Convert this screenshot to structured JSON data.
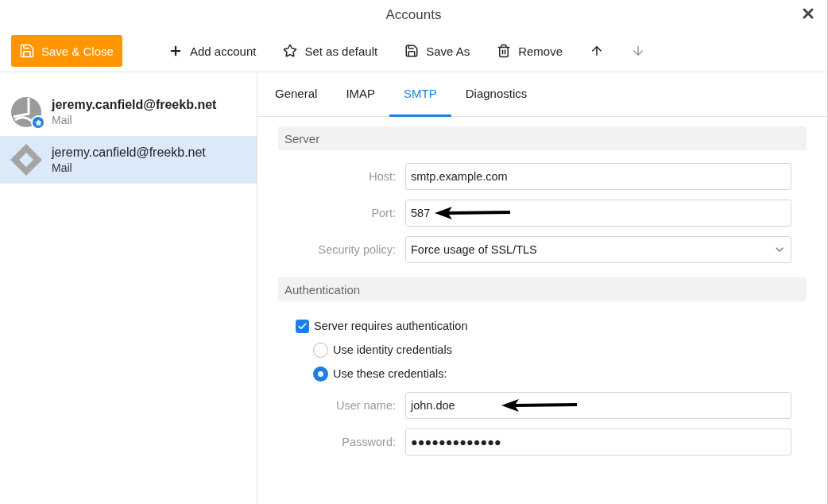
{
  "window": {
    "title": "Accounts"
  },
  "toolbar": {
    "primary": {
      "label": "Save & Close"
    },
    "items": [
      {
        "kind": "add",
        "label": "Add account",
        "disabled": false
      },
      {
        "kind": "star",
        "label": "Set as default",
        "disabled": false
      },
      {
        "kind": "save",
        "label": "Save As",
        "disabled": false
      },
      {
        "kind": "trash",
        "label": "Remove",
        "disabled": false
      },
      {
        "kind": "up",
        "disabled": false
      },
      {
        "kind": "down",
        "disabled": true
      }
    ]
  },
  "accounts": [
    {
      "kind": "pie",
      "name": "jeremy.canfield@freekb.net",
      "type": "Mail",
      "default": true,
      "selected": false
    },
    {
      "kind": "diamond",
      "name": "jeremy.canfield@freekb.net",
      "type": "Mail",
      "default": false,
      "selected": true
    }
  ],
  "tabs": [
    {
      "label": "General",
      "selected": false
    },
    {
      "label": "IMAP",
      "selected": false
    },
    {
      "label": "SMTP",
      "selected": true
    },
    {
      "label": "Diagnostics",
      "selected": false
    }
  ],
  "server": {
    "heading": "Server",
    "fields": [
      {
        "kind": "text",
        "label": "Host:",
        "value": "smtp.example.com"
      },
      {
        "kind": "text",
        "label": "Port:",
        "value": "587",
        "annotation_arrow": true
      },
      {
        "kind": "select",
        "label": "Security policy:",
        "value": "Force usage of SSL/TLS"
      }
    ]
  },
  "authentication": {
    "heading": "Authentication",
    "checkbox": {
      "label": "Server requires authentication",
      "checked": true
    },
    "radios": [
      {
        "label": "Use identity credentials",
        "selected": false
      },
      {
        "label": "Use these credentials:",
        "selected": true
      }
    ],
    "fields": [
      {
        "kind": "text",
        "label": "User name:",
        "value": "john.doe",
        "annotation_arrow": true
      },
      {
        "kind": "text",
        "label": "Password:",
        "value": "●●●●●●●●●●●●●"
      }
    ]
  }
}
